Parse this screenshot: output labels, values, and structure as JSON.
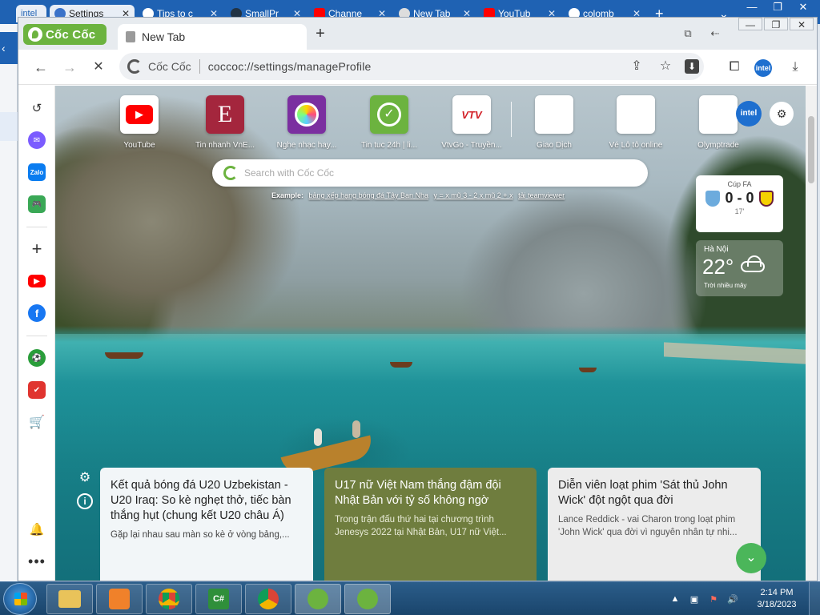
{
  "back_browser": {
    "tabs": [
      {
        "label": "intel",
        "color": "#ffffff"
      },
      {
        "label": "Settings",
        "color": "#1a73e8"
      },
      {
        "label": "Tips to c",
        "color": "#e8e8e8"
      },
      {
        "label": "SmallPr",
        "color": "#333333"
      },
      {
        "label": "Channe",
        "color": "#ff0000"
      },
      {
        "label": "New Tab",
        "color": "#e8e8e8"
      },
      {
        "label": "YouTub",
        "color": "#ff0000"
      },
      {
        "label": "colomb",
        "color": "#e8e8e8"
      }
    ],
    "new_tab_symbol": "+",
    "chevron": "⌄",
    "window_controls": [
      "—",
      "❐",
      "✕"
    ]
  },
  "app": {
    "name": "Cốc Cốc",
    "tab_title": "New Tab",
    "new_tab_symbol": "+",
    "window_controls": [
      "—",
      "❐",
      "✕"
    ]
  },
  "toolbar": {
    "site_label": "Cốc Cốc",
    "url": "coccoc://settings/manageProfile"
  },
  "speed_dial": [
    {
      "label": "YouTube",
      "bg": "#ffffff",
      "fg": "#ff0000",
      "glyph": "▶"
    },
    {
      "label": "Tin nhanh VnE...",
      "bg": "#a4263d",
      "fg": "#ffffff",
      "glyph": "E"
    },
    {
      "label": "Nghe nhạc hay...",
      "bg": "#7b2fa0",
      "fg": "#ffffff",
      "glyph": "◉"
    },
    {
      "label": "Tin tuc 24h | li...",
      "bg": "#6cb33f",
      "fg": "#ffffff",
      "glyph": "↻"
    },
    {
      "label": "VtvGo - Truyền...",
      "bg": "#ffffff",
      "fg": "#d21f26",
      "glyph": "VTV"
    },
    {
      "label": "Giao Dịch",
      "bg": "#ffffff",
      "fg": "#999999",
      "glyph": ""
    },
    {
      "label": "Vé Lô tô online",
      "bg": "#ffffff",
      "fg": "#999999",
      "glyph": ""
    },
    {
      "label": "Olymptrade",
      "bg": "#ffffff",
      "fg": "#999999",
      "glyph": ""
    }
  ],
  "intel_badge": "intel",
  "search": {
    "placeholder": "Search with Cốc Cốc",
    "example_label": "Example:",
    "examples": [
      "bảng xếp hạng bóng đá Tây Ban Nha",
      "y = x mũ 3 - 2 x mũ 2 + x",
      "tải teamviewer"
    ]
  },
  "football": {
    "competition": "Cúp FA",
    "score": "0 - 0",
    "minute": "17'",
    "home_color": "#6cabdd",
    "away_color": "#f5d000"
  },
  "weather": {
    "city": "Hà Nội",
    "temperature": "22°",
    "condition": "Trời nhiều mây"
  },
  "news": [
    {
      "title": "Kết quả bóng đá U20 Uzbekistan - U20 Iraq: So kè nghẹt thở, tiếc bàn thắng hụt (chung kết U20 châu Á)",
      "desc": "Gặp lại nhau sau màn so kè ở vòng bảng,..."
    },
    {
      "title": "U17 nữ Việt Nam thắng đậm đội Nhật Bản với tỷ số không ngờ",
      "desc": "Trong trận đấu thứ hai tại chương trình Jenesys 2022 tại Nhật Bản, U17 nữ Việt..."
    },
    {
      "title": "Diễn viên loạt phim 'Sát thủ John Wick' đột ngột qua đời",
      "desc": "Lance Reddick - vai Charon trong loạt phim 'John Wick' qua đời vì nguyên nhân tự nhi..."
    }
  ],
  "sidebar_colors": {
    "messenger": "#7b5cff",
    "zalo": "#0a7cf0",
    "game": "#3aa856",
    "youtube": "#ff0000",
    "facebook": "#1877f2",
    "football": "#2a9d3a",
    "todo": "#e0342f",
    "shop": "#f07820"
  },
  "taskbar": {
    "time": "2:14 PM",
    "date": "3/18/2023",
    "apps": [
      "file-explorer",
      "media-player",
      "chrome-intel",
      "csharp-editor",
      "chrome-intel-2",
      "coccoc-1",
      "coccoc-2"
    ]
  }
}
